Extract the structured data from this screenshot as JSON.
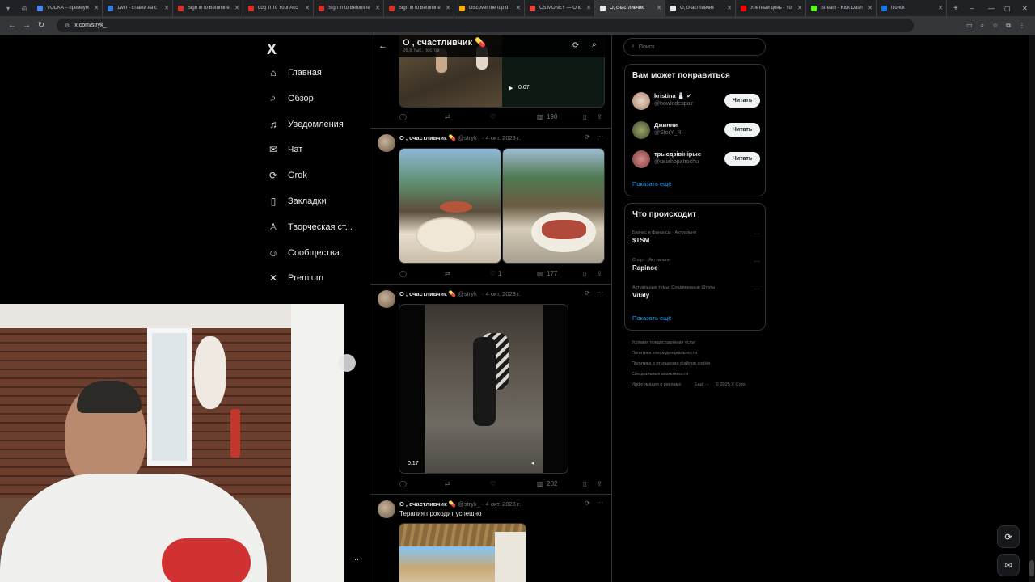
{
  "browser": {
    "tabs": [
      {
        "title": "VODKA – премиум",
        "color": "#4285f4"
      },
      {
        "title": "1win - ставки на с",
        "color": "#3a7bd5"
      },
      {
        "title": "Sign in to Betonline",
        "color": "#d93025"
      },
      {
        "title": "Log in To Your Acc",
        "color": "#d93025"
      },
      {
        "title": "Sign in to Betonline",
        "color": "#d93025"
      },
      {
        "title": "Sign in to Betonline",
        "color": "#d93025"
      },
      {
        "title": "Discover the top d",
        "color": "#f9ab00"
      },
      {
        "title": "CS.MONEY — Ofic",
        "color": "#e8453c"
      },
      {
        "title": "О, счастливчик",
        "color": "#e7e9ea",
        "active": true
      },
      {
        "title": "О, счастливчик",
        "color": "#e7e9ea"
      },
      {
        "title": "Улетный день - Yo",
        "color": "#ff0000"
      },
      {
        "title": "Stream - Kick Dash",
        "color": "#53fc18"
      },
      {
        "title": "Поиск",
        "color": "#1a73e8"
      }
    ],
    "url": "x.com/stryk_"
  },
  "nav": {
    "logo": "X",
    "items": [
      {
        "label": "Главная",
        "icon": "home-icon"
      },
      {
        "label": "Обзор",
        "icon": "search-icon"
      },
      {
        "label": "Уведомления",
        "icon": "bell-icon"
      },
      {
        "label": "Чат",
        "icon": "mail-icon"
      },
      {
        "label": "Grok",
        "icon": "grok-icon"
      },
      {
        "label": "Закладки",
        "icon": "bookmark-icon"
      },
      {
        "label": "Творческая ст...",
        "icon": "creator-icon"
      },
      {
        "label": "Сообщества",
        "icon": "communities-icon"
      },
      {
        "label": "Premium",
        "icon": "premium-icon"
      }
    ]
  },
  "profile": {
    "name": "О , счастливчик 💊",
    "posts": "26,8 тыс. постов"
  },
  "tweets": [
    {
      "video_time": "0:07",
      "views": "190"
    },
    {
      "name": "О , счастливчик 💊",
      "handle": "@stryk_",
      "date": "4 окт. 2023 г.",
      "likes": "1",
      "views": "177"
    },
    {
      "name": "О , счастливчик 💊",
      "handle": "@stryk_",
      "date": "4 окт. 2023 г.",
      "video_time": "0:17",
      "views": "202"
    },
    {
      "name": "О , счастливчик 💊",
      "handle": "@stryk_",
      "date": "4 окт. 2023 г.",
      "text": "Терапия проходит успешно"
    }
  ],
  "sidebar": {
    "search_placeholder": "Поиск",
    "suggest_title": "Вам может понравиться",
    "suggestions": [
      {
        "name": "kristina 🧂 ✔",
        "handle": "@howlndespair",
        "button": "Читать"
      },
      {
        "name": "Джинни",
        "handle": "@StorY_RI",
        "button": "Читать"
      },
      {
        "name": "трыєдзівінірыс",
        "handle": "@usiahopatrochu",
        "button": "Читать"
      }
    ],
    "show_more": "Показать ещё",
    "trends_title": "Что происходит",
    "trends": [
      {
        "category": "Бизнес и финансы · Актуально",
        "name": "$TSM"
      },
      {
        "category": "Спорт · Актуально",
        "name": "Rapinoe"
      },
      {
        "category": "Актуальные темы: Соединенные Штаты",
        "name": "Vitaly"
      }
    ],
    "show_more2": "Показать ещё",
    "footer": [
      "Условия предоставления услуг",
      "Политика конфиденциальности",
      "Политика в отношении файлов cookie",
      "Специальные возможности",
      "Информация о рекламе",
      "Ещё ···",
      "© 2025 X Corp."
    ]
  }
}
